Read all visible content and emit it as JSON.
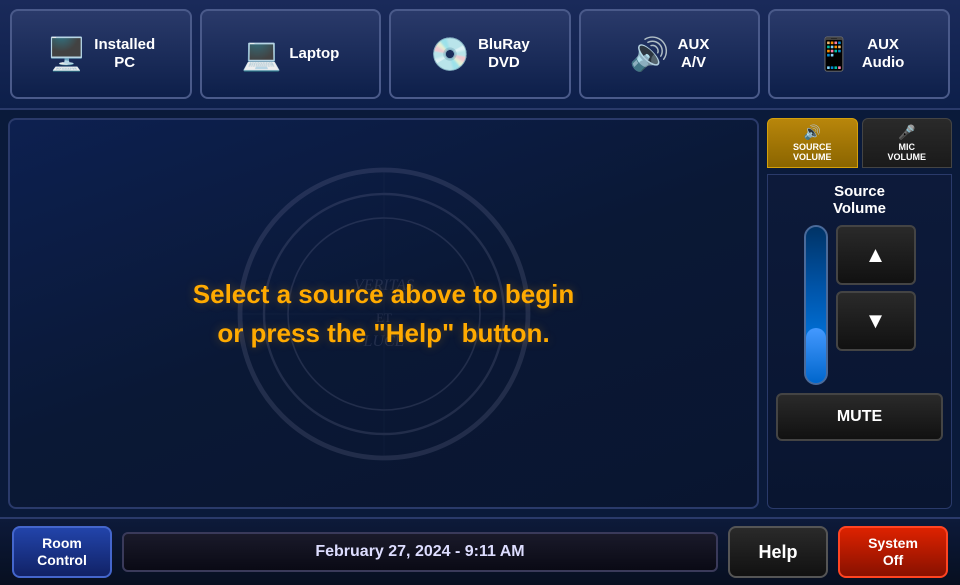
{
  "sourceBar": {
    "buttons": [
      {
        "id": "installed-pc",
        "label": "Installed\nPC",
        "icon": "🖥️"
      },
      {
        "id": "laptop",
        "label": "Laptop",
        "icon": "💻"
      },
      {
        "id": "bluray-dvd",
        "label": "BluRay\nDVD",
        "icon": "💿"
      },
      {
        "id": "aux-av",
        "label": "AUX\nA/V",
        "icon": "🔊"
      },
      {
        "id": "aux-audio",
        "label": "AUX\nAudio",
        "icon": "📱"
      }
    ]
  },
  "mainMessage": {
    "line1": "Select a source above to begin",
    "line2": "or press the \"Help\" button."
  },
  "volumePanel": {
    "tabs": [
      {
        "id": "source-volume",
        "label": "SOURCE\nVOLUME",
        "active": true,
        "icon": "🔊"
      },
      {
        "id": "mic-volume",
        "label": "MIC\nVOLUME",
        "active": false,
        "icon": "🎤"
      }
    ],
    "sectionLabel": "Source\nVolume",
    "upButtonLabel": "▲",
    "downButtonLabel": "▼",
    "muteButtonLabel": "MUTE"
  },
  "bottomBar": {
    "roomControlLabel": "Room\nControl",
    "dateTimeLabel": "February 27, 2024  -  9:11 AM",
    "helpLabel": "Help",
    "systemOffLabel": "System\nOff"
  }
}
